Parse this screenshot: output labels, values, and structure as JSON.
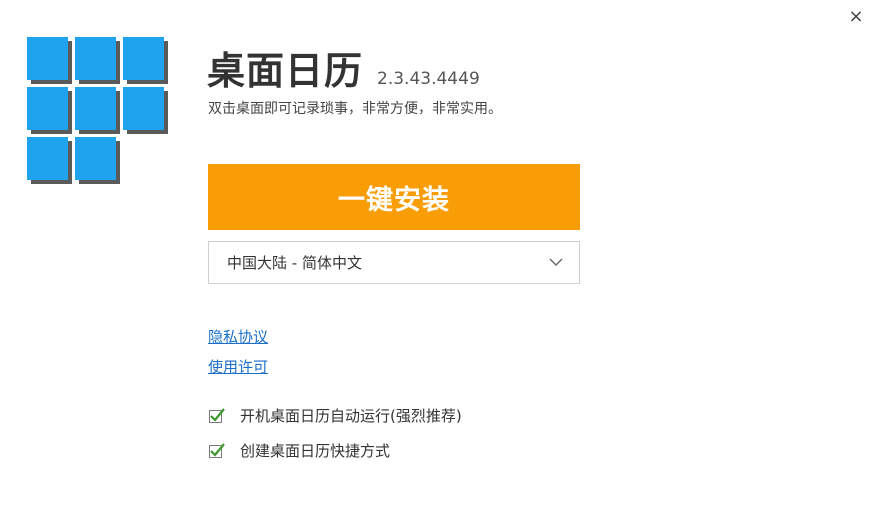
{
  "window": {
    "close_glyph": "×"
  },
  "app": {
    "title": "桌面日历",
    "version": "2.3.43.4449",
    "description": "双击桌面即可记录琐事，非常方便，非常实用。",
    "logo_icon": "calendar-grid-logo",
    "logo_color": "#1fa3ee"
  },
  "install": {
    "button_label": "一键安装",
    "button_color": "#f99d06"
  },
  "language": {
    "selected": "中国大陆 - 简体中文",
    "icon": "chevron-down-icon"
  },
  "links": {
    "privacy": "隐私协议",
    "license": "使用许可",
    "color": "#1a6fc9"
  },
  "options": {
    "autostart": {
      "label": "开机桌面日历自动运行(强烈推荐)",
      "checked": true
    },
    "shortcut": {
      "label": "创建桌面日历快捷方式",
      "checked": true
    }
  }
}
